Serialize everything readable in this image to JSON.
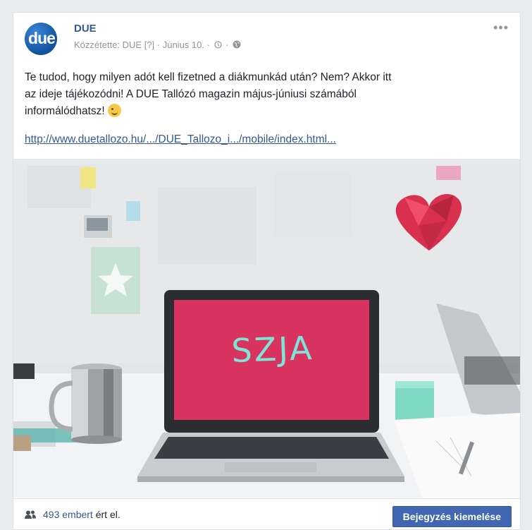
{
  "post": {
    "page_name": "DUE",
    "avatar_text": "due",
    "meta_text": "Közzétette: DUE [?] · Június 10. ·",
    "more_label": "•••",
    "body_line1": "Te tudod, hogy milyen adót kell fizetned a diákmunkád után? Nem? Akkor itt",
    "body_line2": "az ideje tájékozódni! A DUE Tallózó magazin május-júniusi számából",
    "body_line3": "informálódhatsz!",
    "link": "http://www.duetallozo.hu/.../DUE_Tallozo_i.../mobile/index.html...",
    "image_text": "SZJA"
  },
  "footer": {
    "reach_count": "493 embert",
    "reach_suffix": " ért el.",
    "boost_label": "Bejegyzés kiemelése"
  },
  "colors": {
    "link": "#365899",
    "button": "#4267b2",
    "screen": "#d9345f"
  },
  "icons": [
    "clock-icon",
    "globe-icon",
    "people-icon",
    "heart-icon",
    "wink-emoji-icon"
  ]
}
